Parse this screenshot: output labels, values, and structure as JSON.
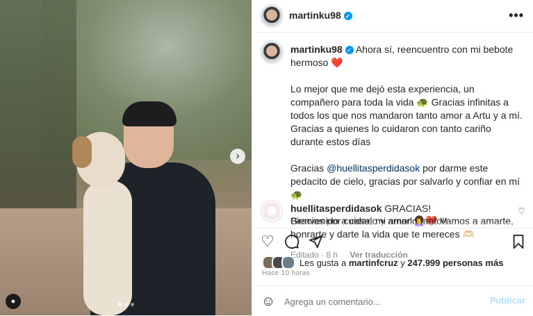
{
  "post": {
    "username": "martinku98",
    "verified_icon": "verified-badge-icon",
    "more_icon": "more-horizontal-icon"
  },
  "caption": {
    "line1_text": "Ahora sí, reencuentro con mi bebote hermoso",
    "heart": "❤️",
    "para2": "Lo mejor que me dejó esta experiencia, un compañero para toda la vida 🐢 Gracias infinitas a todos los que nos mandaron tanto amor a Artu y a mí. Gracias a quienes lo cuidaron con tanto cariño durante estos días",
    "para3_before": "Gracias ",
    "para3_mention": "@huellitasperdidasok",
    "para3_after": " por darme este pedacito de cielo, gracias por salvarlo y confiar en mí 🐢",
    "para4": "Bienvenido a casa, mi amor 👩‍🦱❤️ Vamos a amarte, honrarte y darte la vida que te mereces 🫶🏻",
    "edited": "Editado · 8 h",
    "translate": "Ver traducción"
  },
  "comment": {
    "username": "huellitasperdidasok",
    "text": "GRACIAS!",
    "line2": "Gracias por cuidarlo y amarlo tanto!!"
  },
  "likes": {
    "prefix": "Les gusta a",
    "user": "martinfcruz",
    "mid": "y",
    "count": "247.999 personas más"
  },
  "time": "Hace 10 horas",
  "composer": {
    "placeholder": "Agrega un comentario...",
    "post_label": "Publicar"
  },
  "icons": {
    "heart": "heart-icon",
    "comment": "comment-icon",
    "share": "share-icon",
    "save": "bookmark-icon",
    "emoji": "emoji-icon",
    "next": "chevron-right-icon",
    "tag": "user-tag-icon"
  },
  "carousel": {
    "slides": 3,
    "active": 1
  }
}
